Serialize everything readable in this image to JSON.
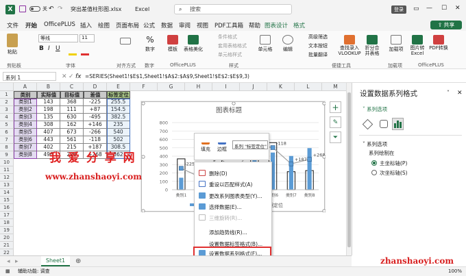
{
  "titlebar": {
    "autosave": "自动保存",
    "toggle": "关",
    "filename": "突出差值柱形图.xlsx",
    "app": "Excel",
    "search_placeholder": "搜索",
    "login": "登录"
  },
  "menu": {
    "tabs": [
      "文件",
      "开始",
      "OfficePLUS",
      "插入",
      "绘图",
      "页面布局",
      "公式",
      "数据",
      "审阅",
      "视图",
      "PDF工具箱",
      "帮助",
      "图表设计",
      "格式"
    ],
    "share": "共享"
  },
  "ribbon": {
    "clipboard": {
      "label": "剪贴板",
      "paste": "粘贴"
    },
    "font": {
      "label": "字体",
      "name": "等线",
      "size": "11"
    },
    "align": {
      "label": "对齐方式"
    },
    "number": {
      "label": "数字",
      "percent": "%",
      "text": "数字"
    },
    "officeplus": {
      "label": "OfficePLUS",
      "template": "模板",
      "beautify": "表格美化"
    },
    "styles": {
      "label": "样式",
      "cond": "条件格式",
      "table": "套用表格格式",
      "cell": "单元格样式"
    },
    "cells": {
      "label": "单元格"
    },
    "edit": {
      "label": "编辑"
    },
    "tools": {
      "label": "便捷工具",
      "filter": "高级筛选",
      "text": "文本按钮",
      "batch": "批量翻译",
      "vlookup": "查找录入 VLOOKUP",
      "split": "折分合并表格"
    },
    "addins": {
      "label": "加载项",
      "name": "加载项"
    },
    "officeplus2": {
      "label": "OfficePLUS",
      "image": "图片转Excel",
      "pdf": "PDF转换"
    }
  },
  "formulabar": {
    "namebox": "系列 1",
    "fx": "fx",
    "formula": "=SERIES(Sheet1!$E$1,Sheet1!$A$2:$A$9,Sheet1!$E$2:$E$9,3)"
  },
  "sheet": {
    "cols": [
      "A",
      "B",
      "C",
      "D",
      "E",
      "F",
      "G",
      "H",
      "I",
      "J",
      "K",
      "L",
      "M"
    ],
    "header": [
      "类别",
      "实际值",
      "目标值",
      "差值",
      "标签定位"
    ],
    "rows": [
      [
        "类别1",
        "143",
        "368",
        "-225",
        "255.5"
      ],
      [
        "类别2",
        "198",
        "111",
        "+87",
        "154.5"
      ],
      [
        "类别3",
        "135",
        "630",
        "-495",
        "382.5"
      ],
      [
        "类别4",
        "308",
        "162",
        "+146",
        "235"
      ],
      [
        "类别5",
        "407",
        "673",
        "-266",
        "540"
      ],
      [
        "类别6",
        "443",
        "561",
        "-118",
        "502"
      ],
      [
        "类别7",
        "402",
        "215",
        "+187",
        "308.5"
      ],
      [
        "类别8",
        "496",
        "228",
        "+268",
        "362"
      ]
    ],
    "row_numbers": [
      "1",
      "2",
      "3",
      "4",
      "5",
      "6",
      "7",
      "8",
      "9",
      "10",
      "11",
      "12",
      "13",
      "14",
      "15",
      "16",
      "17",
      "18",
      "19",
      "20",
      "21",
      "22",
      "23"
    ]
  },
  "chart": {
    "title": "图表标题",
    "y_ticks": [
      "800",
      "700",
      "600",
      "500",
      "400",
      "300",
      "200",
      "100",
      "0"
    ],
    "x_axis_label": "数据定位",
    "visible_labels": [
      "-225",
      "+87",
      "-118",
      "+187",
      "+268"
    ]
  },
  "chart_data": {
    "type": "bar",
    "title": "图表标题",
    "categories": [
      "类别1",
      "类别2",
      "类别3",
      "类别4",
      "类别5",
      "类别6",
      "类别7",
      "类别8"
    ],
    "ylim": [
      0,
      800
    ],
    "series": [
      {
        "name": "实际值",
        "values": [
          143,
          198,
          135,
          308,
          407,
          443,
          402,
          496
        ]
      },
      {
        "name": "目标值",
        "values": [
          368,
          111,
          630,
          162,
          673,
          561,
          215,
          228
        ]
      },
      {
        "name": "标签定位",
        "values": [
          255.5,
          154.5,
          382.5,
          235,
          540,
          502,
          308.5,
          362
        ]
      }
    ],
    "data_labels": [
      "-225",
      "+87",
      "-495",
      "+146",
      "-266",
      "-118",
      "+187",
      "+268"
    ]
  },
  "minitoolbar": {
    "fill": "填充",
    "outline": "边框",
    "series_select": "系列 \"标签定位\""
  },
  "context_menu": {
    "items": [
      "删除(D)",
      "重设以匹配样式(A)",
      "更改系列图表类型(Y)...",
      "选择数据(E)...",
      "三维旋转(R)...",
      "添加趋势线(R)...",
      "设置数据标签格式(B)...",
      "设置数据系列格式(F)..."
    ]
  },
  "watermark": {
    "title": "我 爱 分 享 网",
    "url": "www.zhanshaoyi.com",
    "url2": "zhanshaoyi.com"
  },
  "pane": {
    "title": "设置数据系列格式",
    "section": "系列选项",
    "subsection": "系列选项",
    "plot_on": "系列绘制在",
    "primary": "主坐标轴(P)",
    "secondary": "次坐标轴(S)"
  },
  "sheettabs": {
    "sheet": "Sheet1"
  },
  "status": {
    "accessibility": "辅助功能: 调查",
    "zoom": "100%"
  },
  "colors": {
    "accent": "#217346",
    "bar": "#5b9bd5",
    "highlight_red": "#e03030"
  }
}
